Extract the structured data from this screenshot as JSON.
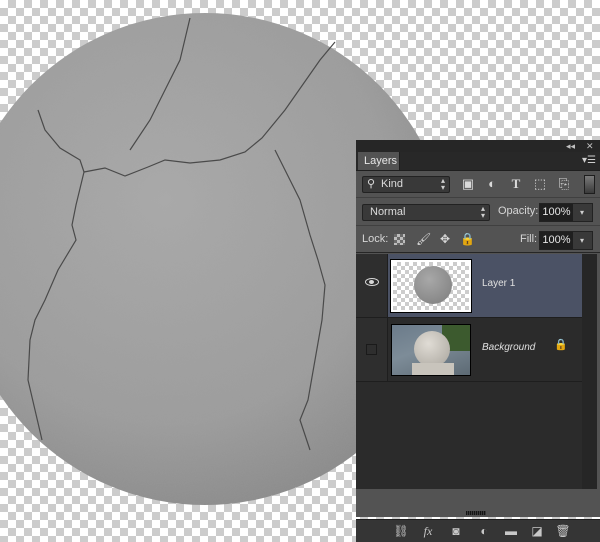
{
  "canvas": {
    "content": "cracked concrete sphere on transparent background",
    "transparency": "checkerboard"
  },
  "panel": {
    "title_controls": {
      "collapse_icon": "double-left-arrow-icon",
      "close_icon": "close-icon"
    },
    "tab_label": "Layers",
    "menu_icon": "panel-menu-icon",
    "filter": {
      "kind_label": "Kind",
      "icons": [
        "image-filter-icon",
        "adjustment-filter-icon",
        "type-filter-icon",
        "shape-filter-icon",
        "smart-object-filter-icon",
        "filter-toggle-icon"
      ]
    },
    "blend_mode": "Normal",
    "opacity_label": "Opacity:",
    "opacity_value": "100%",
    "lock_label": "Lock:",
    "lock_icons": [
      "lock-transparent-pixels-icon",
      "lock-image-pixels-icon",
      "lock-position-icon",
      "lock-all-icon"
    ],
    "fill_label": "Fill:",
    "fill_value": "100%",
    "layers": [
      {
        "name": "Layer 1",
        "visible": true,
        "selected": true,
        "locked": false
      },
      {
        "name": "Background",
        "visible": false,
        "selected": false,
        "locked": true
      }
    ],
    "footer_icons": [
      "link-layers-icon",
      "fx-icon",
      "add-mask-icon",
      "adjustment-layer-icon",
      "new-group-icon",
      "new-layer-icon",
      "delete-icon"
    ],
    "footer_fx_label": "fx",
    "colors": {
      "panel_bg": "#535353",
      "selected_layer": "#4b5265",
      "list_bg": "#2b2b2b"
    }
  }
}
